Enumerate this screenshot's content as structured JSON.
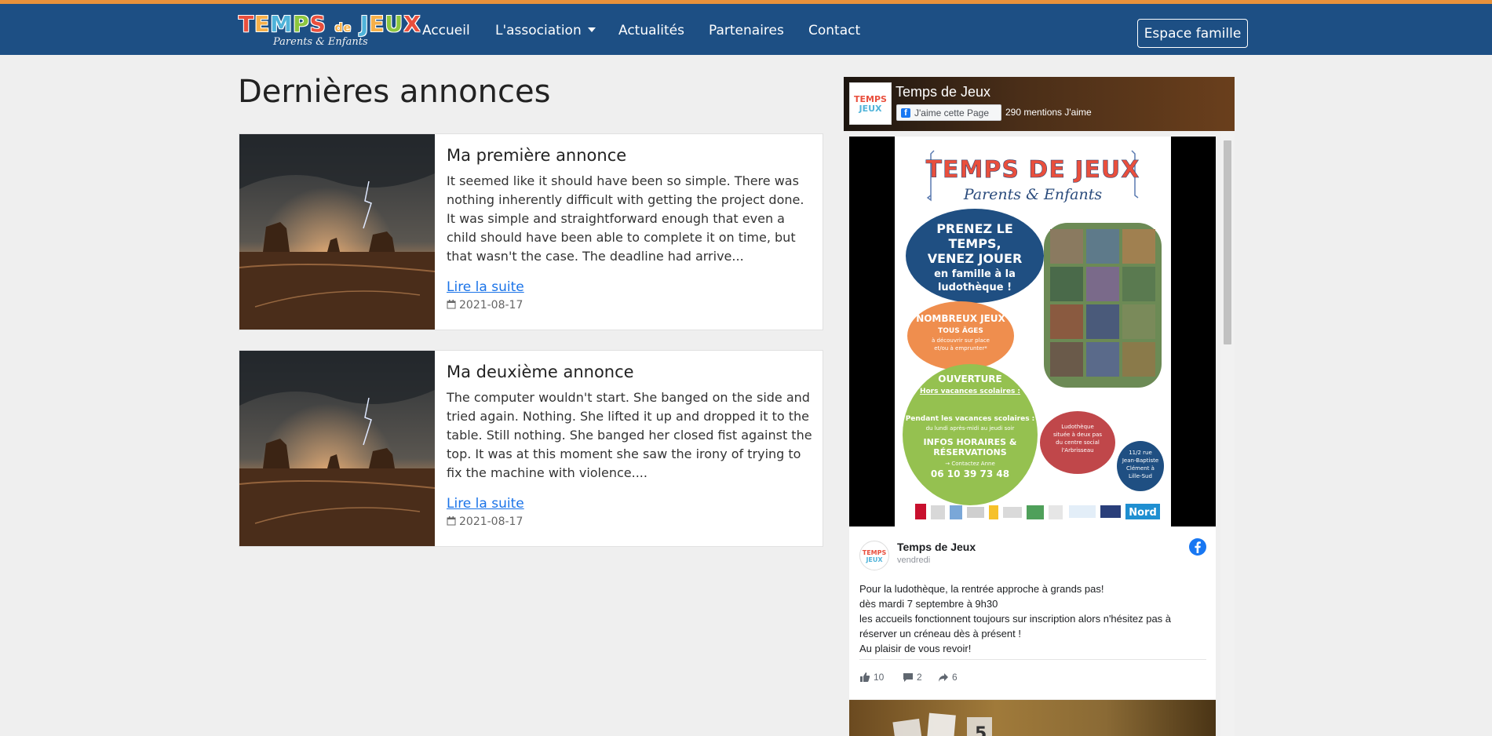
{
  "navbar": {
    "brand": {
      "title": "TEMPS DE JEUX",
      "subtitle": "Parents & Enfants"
    },
    "links": [
      "Accueil",
      "L'association",
      "Actualités",
      "Partenaires",
      "Contact"
    ],
    "family_button": "Espace famille"
  },
  "main": {
    "heading": "Dernières annonces",
    "posts": [
      {
        "title": "Ma première annonce",
        "excerpt": "It seemed like it should have been so simple. There was nothing inherently difficult with getting the project done. It was simple and straightforward enough that even a child should have been able to complete it on time, but that wasn't the case. The deadline had arrive...",
        "link": "Lire la suite",
        "date": "2021-08-17"
      },
      {
        "title": "Ma deuxième annonce",
        "excerpt": "The computer wouldn't start. She banged on the side and tried again. Nothing. She lifted it up and dropped it to the table. Still nothing. She banged her closed fist against the top. It was at this moment she saw the irony of trying to fix the machine with violence....",
        "link": "Lire la suite",
        "date": "2021-08-17"
      }
    ]
  },
  "facebook": {
    "page_name": "Temps de Jeux",
    "like_button": "J'aime cette Page",
    "likes": "290 mentions J'aime",
    "post": {
      "author": "Temps de Jeux",
      "time": "vendredi",
      "lines": [
        "Pour la ludothèque, la rentrée approche à grands pas!",
        "dès mardi 7 septembre à 9h30",
        "les accueils fonctionnent toujours sur inscription alors n'hésitez pas à",
        "réserver un créneau dès à présent !",
        "Au plaisir de vous revoir!"
      ],
      "reactions": "10",
      "comments": "2",
      "shares": "6"
    },
    "poster": {
      "title": "TEMPS DE JEUX",
      "subtitle": "Parents & Enfants",
      "headline": [
        "PRENEZ LE",
        "TEMPS,",
        "VENEZ JOUER",
        "en famille à la",
        "ludothèque !"
      ],
      "games": [
        "NOMBREUX JEUX",
        "TOUS ÂGES",
        "à découvrir sur place",
        "et/ou à emprunter*"
      ],
      "opening": [
        "OUVERTURE",
        "Hors vacances scolaires :",
        "Pendant les vacances scolaires :",
        "du lundi après-midi au jeudi soir"
      ],
      "infos": [
        "INFOS HORAIRES &",
        "RÉSERVATIONS",
        "→ Contactez Anne",
        "06 10 39 73 48"
      ],
      "location": [
        "Ludothèque",
        "située à deux pas",
        "du centre social",
        "l'Arbrisseau"
      ],
      "address": [
        "11/2 rue",
        "Jean-Baptiste",
        "Clément à",
        "Lille-Sud"
      ],
      "partner": "Nord"
    }
  },
  "colors": {
    "navbar": "#1d4f84",
    "accent_line": "#e8913a",
    "link": "#1a73e8"
  }
}
